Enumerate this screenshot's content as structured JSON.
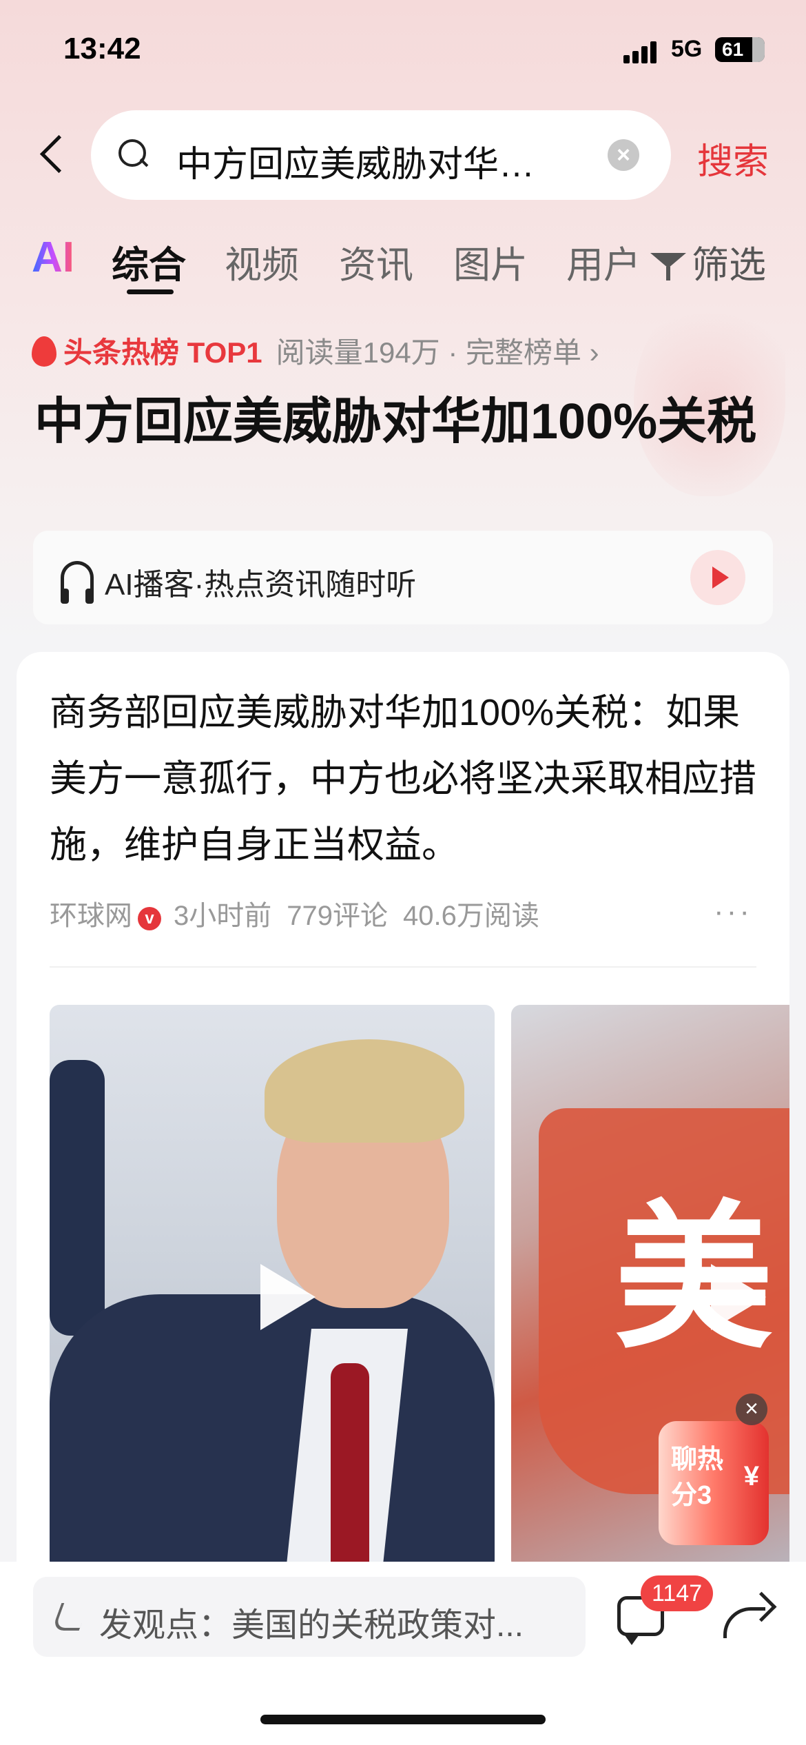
{
  "status_bar": {
    "time": "13:42",
    "network": "5G",
    "battery": "61"
  },
  "search": {
    "query": "中方回应美威胁对华…",
    "button_label": "搜索"
  },
  "tabs": {
    "ai_label": "AI",
    "items": [
      "综合",
      "视频",
      "资讯",
      "图片",
      "用户"
    ],
    "active_index": 0,
    "filter_label": "筛选"
  },
  "hot": {
    "label": "头条热榜 TOP1",
    "meta": "阅读量194万 · 完整榜单 ›"
  },
  "headline": "中方回应美威胁对华加100%关税",
  "podcast": {
    "text": "AI播客·热点资讯随时听"
  },
  "article": {
    "title": "商务部回应美威胁对华加100%关税：如果美方一意孤行，中方也必将坚决采取相应措施，维护自身正当权益。",
    "source": "环球网",
    "verified_mark": "v",
    "time": "3小时前",
    "comments": "779评论",
    "reads": "40.6万阅读",
    "more": "···",
    "image2_char": "美"
  },
  "promo": {
    "text": "聊热分3",
    "yen": "¥",
    "close": "×"
  },
  "bottom_bar": {
    "comment_placeholder": "发观点：美国的关税政策对...",
    "comment_count": "1147"
  },
  "colors": {
    "accent": "#e5363b",
    "badge": "#f04343"
  }
}
